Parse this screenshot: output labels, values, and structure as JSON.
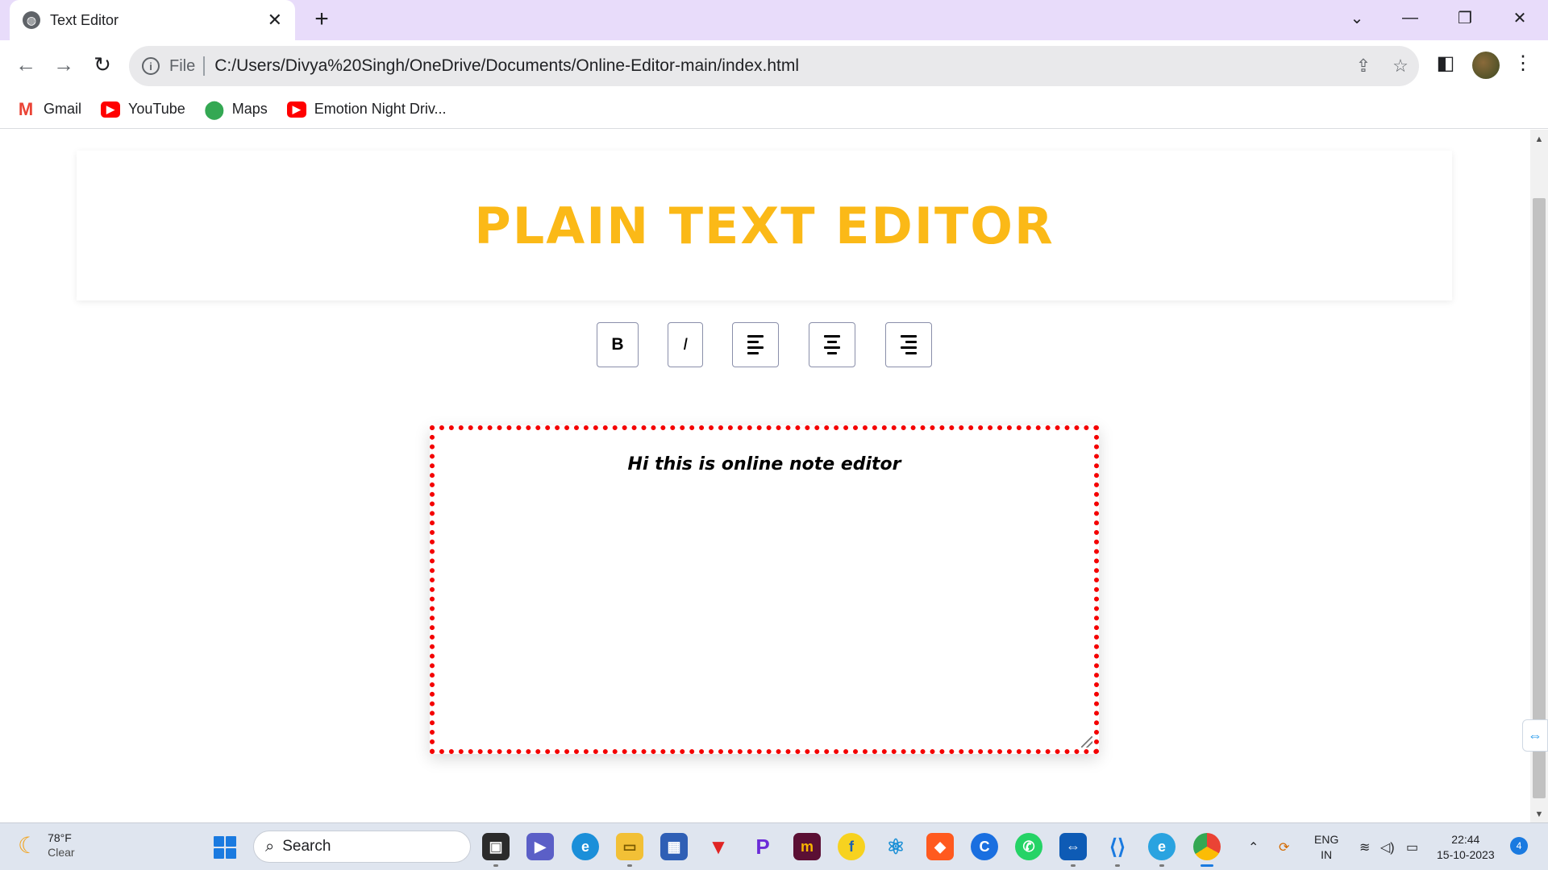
{
  "browser": {
    "tab_title": "Text Editor",
    "address_scheme": "File",
    "address_url": "C:/Users/Divya%20Singh/OneDrive/Documents/Online-Editor-main/index.html",
    "bookmarks": [
      {
        "label": "Gmail",
        "icon": "gmail-icon"
      },
      {
        "label": "YouTube",
        "icon": "youtube-icon"
      },
      {
        "label": "Maps",
        "icon": "maps-icon"
      },
      {
        "label": "Emotion Night Driv...",
        "icon": "youtube-icon"
      }
    ]
  },
  "page": {
    "heading": "PLAIN TEXT EDITOR",
    "heading_color": "#fbb917",
    "toolbar": {
      "bold_label": "B",
      "italic_label": "I",
      "align_left_icon": "align-left-icon",
      "align_center_icon": "align-center-icon",
      "align_right_icon": "align-right-icon"
    },
    "editor": {
      "content": "Hi this is online note editor",
      "border_color": "#f40000"
    }
  },
  "taskbar": {
    "weather_temp": "78°F",
    "weather_condition": "Clear",
    "search_placeholder": "Search",
    "language_line1": "ENG",
    "language_line2": "IN",
    "time": "22:44",
    "date": "15-10-2023",
    "notification_count": "4"
  }
}
